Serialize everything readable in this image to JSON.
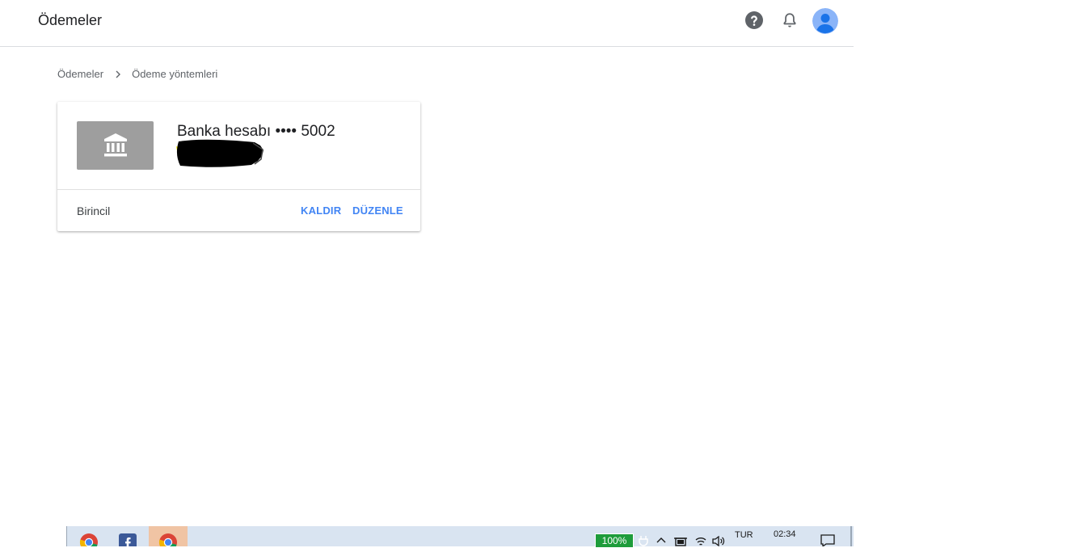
{
  "header": {
    "title": "Ödemeler",
    "icons": [
      "help-icon",
      "bell-icon",
      "avatar"
    ]
  },
  "breadcrumb": {
    "items": [
      "Ödemeler",
      "Ödeme yöntemleri"
    ]
  },
  "payment_card": {
    "icon": "bank-icon",
    "title": "Banka hesabı •••• 5002",
    "status": "Birincil",
    "remove_label": "KALDIR",
    "edit_label": "DÜZENLE"
  },
  "taskbar": {
    "apps": [
      "chrome-icon",
      "facebook-icon",
      "chrome-icon"
    ],
    "battery": "100%",
    "language": "TUR",
    "time": "02:34"
  },
  "colors": {
    "accent": "#4285f4",
    "bank_thumb": "#9e9e9e",
    "avatar": "#8ab4f8",
    "battery": "#1e9c3b",
    "taskbar": "#d9e4f1"
  }
}
